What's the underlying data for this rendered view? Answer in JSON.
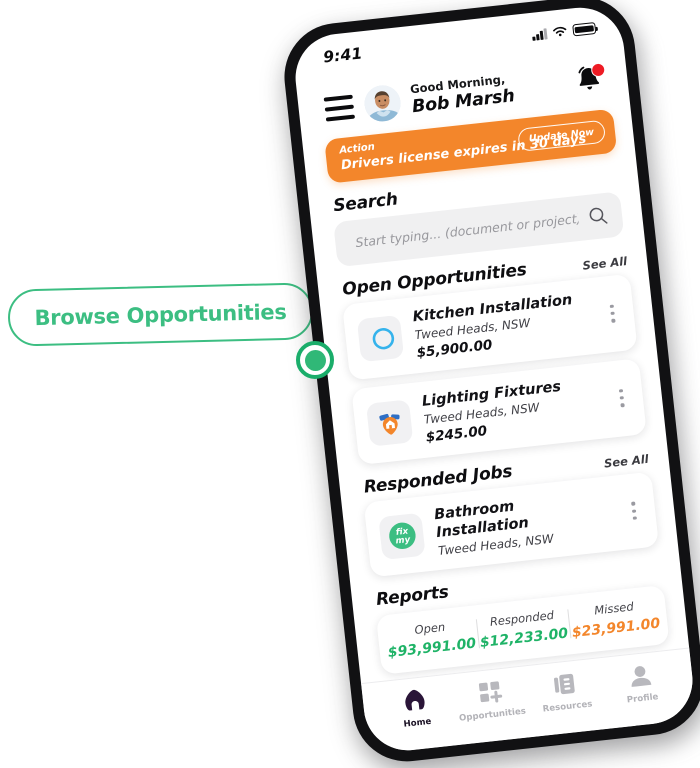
{
  "colors": {
    "accent_green": "#3cbe82",
    "accent_orange": "#f3862b",
    "money_green": "#1fb367",
    "money_orange": "#f3862b",
    "nav_active": "#1b1225"
  },
  "status_bar": {
    "time": "9:41",
    "signal_icon": "cellular-signal-icon",
    "wifi_icon": "wifi-icon",
    "battery_icon": "battery-icon"
  },
  "header": {
    "menu_icon": "hamburger-menu-icon",
    "avatar_icon": "user-avatar-photo",
    "greeting": "Good Morning,",
    "user_name": "Bob Marsh",
    "bell_icon": "notification-bell-icon",
    "has_notification": true
  },
  "banner": {
    "kicker": "Action",
    "message": "Drivers license expires in 30 days",
    "button_label": "Update Now"
  },
  "search": {
    "title": "Search",
    "placeholder": "Start typing... (document or project)",
    "value": "",
    "icon": "search-icon"
  },
  "open_opportunities": {
    "title": "Open Opportunities",
    "see_all": "See All",
    "items": [
      {
        "logo": "blue-crescent-circle-logo",
        "title": "Kitchen Installation",
        "location": "Tweed Heads, NSW",
        "price": "$5,900.00",
        "menu_icon": "kebab-menu-icon"
      },
      {
        "logo": "orange-map-pin-house-logo",
        "title": "Lighting Fixtures",
        "location": "Tweed Heads, NSW",
        "price": "$245.00",
        "menu_icon": "kebab-menu-icon"
      }
    ]
  },
  "responded_jobs": {
    "title": "Responded Jobs",
    "see_all": "See All",
    "items": [
      {
        "logo": "fixmy-green-circle-logo",
        "logo_text": "fix my",
        "title": "Bathroom Installation",
        "location": "Tweed Heads, NSW",
        "menu_icon": "kebab-menu-icon"
      }
    ]
  },
  "reports": {
    "title": "Reports",
    "columns": [
      {
        "label": "Open",
        "value": "$93,991.00",
        "color": "#1fb367"
      },
      {
        "label": "Responded",
        "value": "$12,233.00",
        "color": "#1fb367"
      },
      {
        "label": "Missed",
        "value": "$23,991.00",
        "color": "#f3862b"
      }
    ]
  },
  "bottom_nav": {
    "items": [
      {
        "label": "Home",
        "icon": "home-icon",
        "active": true
      },
      {
        "label": "Opportunities",
        "icon": "grid-plus-icon",
        "active": false
      },
      {
        "label": "Resources",
        "icon": "clipboard-icon",
        "active": false
      },
      {
        "label": "Profile",
        "icon": "person-icon",
        "active": false
      }
    ]
  },
  "callout": {
    "label": "Browse Opportunities",
    "marker_icon": "target-dot-marker"
  }
}
